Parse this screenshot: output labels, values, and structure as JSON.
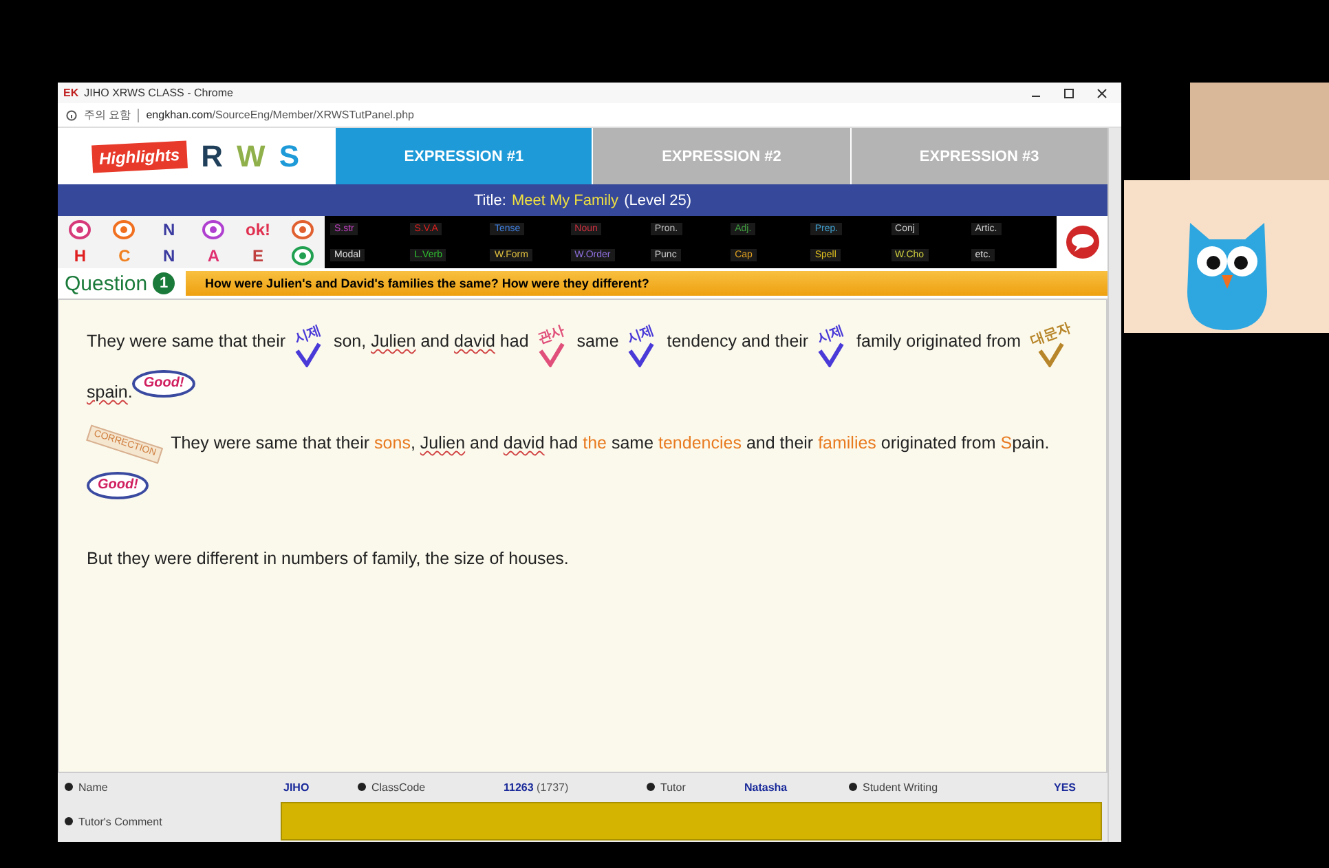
{
  "browser": {
    "badge": "EK",
    "title": "JIHO XRWS CLASS - Chrome",
    "security": "주의 요함",
    "domain": "engkhan.com",
    "path": "/SourceEng/Member/XRWSTutPanel.php"
  },
  "brand": {
    "logo": "Highlights",
    "letters": [
      {
        "text": "R",
        "color": "#1f3f5a"
      },
      {
        "text": "W",
        "color": "#8fb04a"
      },
      {
        "text": "S",
        "color": "#1e9ad8"
      }
    ]
  },
  "tabs": [
    {
      "label": "EXPRESSION #1",
      "selected": true
    },
    {
      "label": "EXPRESSION #2",
      "selected": false
    },
    {
      "label": "EXPRESSION #3",
      "selected": false
    }
  ],
  "title_bar": {
    "label": "Title:",
    "title": "Meet My Family",
    "level": "(Level 25)"
  },
  "palette": [
    {
      "kind": "icon",
      "color": "#d63a7a"
    },
    {
      "kind": "icon",
      "color": "#f07020"
    },
    {
      "kind": "letter",
      "text": "N",
      "color": "#3a3aa0"
    },
    {
      "kind": "icon",
      "color": "#b040d0"
    },
    {
      "kind": "letter",
      "text": "ok!",
      "color": "#e03050"
    },
    {
      "kind": "icon",
      "color": "#e06030"
    },
    {
      "kind": "letter",
      "text": "H",
      "color": "#e02020"
    },
    {
      "kind": "letter",
      "text": "C",
      "color": "#f08020"
    },
    {
      "kind": "letter",
      "text": "N",
      "color": "#3a3aa0"
    },
    {
      "kind": "letter",
      "text": "A",
      "color": "#e03070"
    },
    {
      "kind": "letter",
      "text": "E",
      "color": "#c04040"
    },
    {
      "kind": "icon",
      "color": "#20a050"
    }
  ],
  "error_codes": [
    {
      "text": "S.str",
      "color": "#c040c0"
    },
    {
      "text": "S.V.A",
      "color": "#e02020"
    },
    {
      "text": "Tense",
      "color": "#4080e0"
    },
    {
      "text": "Noun",
      "color": "#d03040"
    },
    {
      "text": "Pron.",
      "color": "#c0c0c0"
    },
    {
      "text": "Adj.",
      "color": "#40a040"
    },
    {
      "text": "Prep.",
      "color": "#40a0d0"
    },
    {
      "text": "Conj",
      "color": "#d0d0d0"
    },
    {
      "text": "Artic.",
      "color": "#d0d0d0"
    },
    {
      "text": "Modal",
      "color": "#e0e0e0"
    },
    {
      "text": "L.Verb",
      "color": "#30c030"
    },
    {
      "text": "W.Form",
      "color": "#e0c040"
    },
    {
      "text": "W.Order",
      "color": "#9070e0"
    },
    {
      "text": "Punc",
      "color": "#d0d0d0"
    },
    {
      "text": "Cap",
      "color": "#e0a020"
    },
    {
      "text": "Spell",
      "color": "#e0c020"
    },
    {
      "text": "W.Cho",
      "color": "#d0d040"
    },
    {
      "text": "etc.",
      "color": "#e0e0e0"
    }
  ],
  "question": {
    "label": "Question",
    "number": "1",
    "prompt": "How were Julien's and David's families the same? How were they different?"
  },
  "paragraphs": [
    {
      "kind": "answer",
      "segments": [
        {
          "kind": "text",
          "text": "They were same that their ",
          "flagged": false,
          "fixed": false
        },
        {
          "kind": "check",
          "label": "시제",
          "color": "#4a3ad8"
        },
        {
          "kind": "text",
          "text": " son, ",
          "flagged": false,
          "fixed": false
        },
        {
          "kind": "text",
          "text": "Julien",
          "flagged": true,
          "fixed": false
        },
        {
          "kind": "text",
          "text": " and ",
          "flagged": false,
          "fixed": false
        },
        {
          "kind": "text",
          "text": "david",
          "flagged": true,
          "fixed": false
        },
        {
          "kind": "text",
          "text": " had ",
          "flagged": false,
          "fixed": false
        },
        {
          "kind": "check",
          "label": "관사",
          "color": "#e0507a"
        },
        {
          "kind": "text",
          "text": " same ",
          "flagged": false,
          "fixed": false
        },
        {
          "kind": "check",
          "label": "시제",
          "color": "#4a3ad8"
        },
        {
          "kind": "text",
          "text": " tendency and their ",
          "flagged": false,
          "fixed": false
        },
        {
          "kind": "check",
          "label": "시제",
          "color": "#4a3ad8"
        },
        {
          "kind": "text",
          "text": " family originated from ",
          "flagged": false,
          "fixed": false
        },
        {
          "kind": "check",
          "label": "대문자",
          "color": "#b8862a"
        },
        {
          "kind": "text",
          "text": "spain",
          "flagged": true,
          "fixed": false
        },
        {
          "kind": "text",
          "text": ".",
          "flagged": false,
          "fixed": false
        },
        {
          "kind": "stamp",
          "label": "Good!"
        }
      ]
    },
    {
      "kind": "correction",
      "tag": "CORRECTION",
      "segments": [
        {
          "kind": "text",
          "text": "They were same that their ",
          "flagged": false,
          "fixed": false
        },
        {
          "kind": "text",
          "text": "sons",
          "flagged": false,
          "fixed": true
        },
        {
          "kind": "text",
          "text": ", ",
          "flagged": false,
          "fixed": false
        },
        {
          "kind": "text",
          "text": "Julien",
          "flagged": true,
          "fixed": false
        },
        {
          "kind": "text",
          "text": " and ",
          "flagged": false,
          "fixed": false
        },
        {
          "kind": "text",
          "text": "david",
          "flagged": true,
          "fixed": false
        },
        {
          "kind": "text",
          "text": " had ",
          "flagged": false,
          "fixed": false
        },
        {
          "kind": "text",
          "text": "the",
          "flagged": false,
          "fixed": true
        },
        {
          "kind": "text",
          "text": " same ",
          "flagged": false,
          "fixed": false
        },
        {
          "kind": "text",
          "text": "tendencies",
          "flagged": false,
          "fixed": true
        },
        {
          "kind": "text",
          "text": " and their ",
          "flagged": false,
          "fixed": false
        },
        {
          "kind": "text",
          "text": "families",
          "flagged": false,
          "fixed": true
        },
        {
          "kind": "text",
          "text": " originated from ",
          "flagged": false,
          "fixed": false
        },
        {
          "kind": "text",
          "text": "S",
          "flagged": false,
          "fixed": true
        },
        {
          "kind": "text",
          "text": "pain.",
          "flagged": false,
          "fixed": false
        },
        {
          "kind": "stamp",
          "label": "Good!"
        }
      ]
    },
    {
      "kind": "plain",
      "segments": [
        {
          "kind": "text",
          "text": "But they were different in numbers of family, the size of houses.",
          "flagged": false,
          "fixed": false
        }
      ]
    }
  ],
  "footer": {
    "fields": [
      {
        "label": "Name",
        "value": "JIHO"
      },
      {
        "label": "ClassCode",
        "value": "11263",
        "extra": "(1737)"
      },
      {
        "label": "Tutor",
        "value": "Natasha"
      },
      {
        "label": "Student Writing",
        "value": "YES"
      }
    ],
    "comment_label": "Tutor's Comment"
  }
}
